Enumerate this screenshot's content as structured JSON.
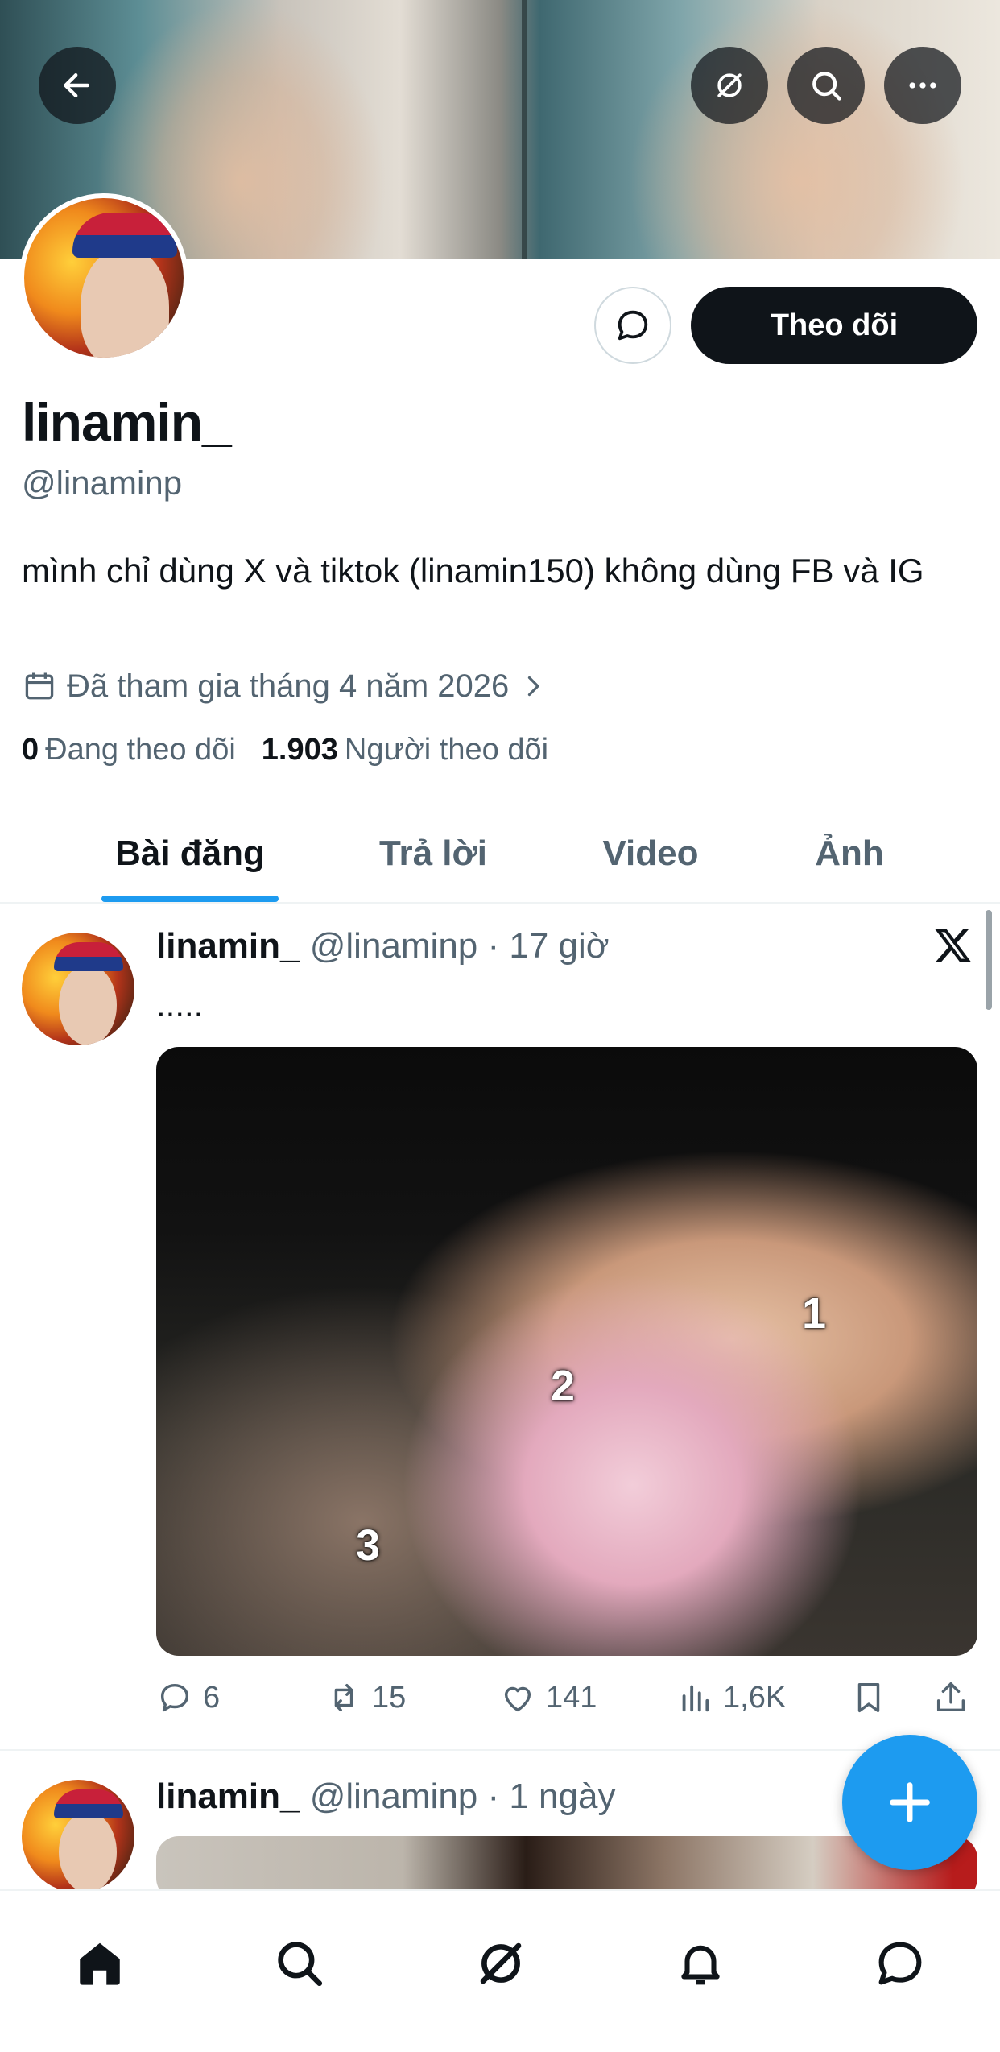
{
  "profile": {
    "display_name": "linamin_",
    "handle": "@linaminp",
    "bio": "mình chỉ dùng X và tiktok (linamin150) không dùng FB và IG",
    "joined": "Đã tham gia tháng 4 năm 2026",
    "following_count": "0",
    "following_label": "Đang theo dõi",
    "followers_count": "1.903",
    "followers_label": "Người theo dõi",
    "follow_button": "Theo dõi"
  },
  "tabs": [
    {
      "label": "Bài đăng",
      "active": true
    },
    {
      "label": "Trả lời",
      "active": false
    },
    {
      "label": "Video",
      "active": false
    },
    {
      "label": "Ảnh",
      "active": false
    }
  ],
  "posts": [
    {
      "name": "linamin_",
      "meta": "@linaminp · 17 giờ",
      "text": ".....",
      "media_labels": [
        "1",
        "2",
        "3"
      ],
      "replies": "6",
      "reposts": "15",
      "likes": "141",
      "views": "1,6K"
    },
    {
      "name": "linamin_",
      "meta": "@linaminp · 1 ngày"
    }
  ],
  "icons": {
    "header": [
      "back-arrow-icon",
      "grok-icon",
      "search-icon",
      "more-icon"
    ],
    "bottom_nav": [
      "home-icon",
      "search-icon",
      "grok-icon",
      "notifications-icon",
      "messages-icon"
    ],
    "fab": "plus-icon"
  },
  "colors": {
    "accent": "#1d9bf0",
    "text_primary": "#0f1419",
    "text_secondary": "#536471",
    "follow_button_bg": "#0f1419"
  }
}
